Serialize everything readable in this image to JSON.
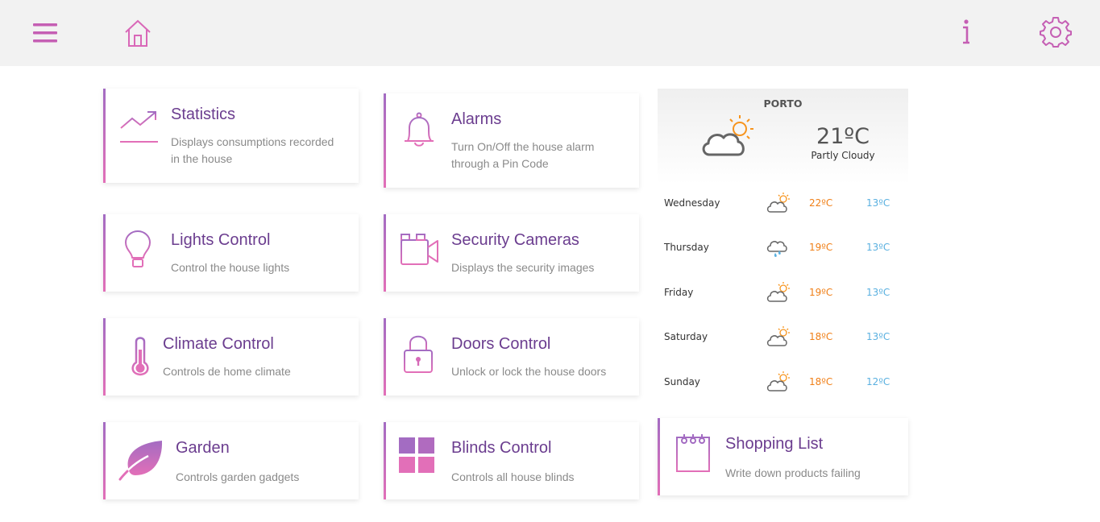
{
  "header": {
    "menu_icon": "hamburger-menu-icon",
    "home_icon": "home-icon",
    "info_icon": "info-icon",
    "settings_icon": "gear-icon"
  },
  "colors": {
    "accent_purple": "#6b3d8f",
    "accent_pink": "#e26fb8",
    "icon_gradient_top": "#a36cc2",
    "temp_high": "#f07f17",
    "temp_low": "#5ab0e0"
  },
  "cards": {
    "statistics": {
      "title": "Statistics",
      "desc": "Displays consumptions recorded in the house",
      "icon": "trend-chart-icon"
    },
    "alarms": {
      "title": "Alarms",
      "desc": "Turn On/Off the house alarm through a Pin Code",
      "icon": "bell-icon"
    },
    "lights": {
      "title": "Lights Control",
      "desc": "Control the house lights",
      "icon": "light-bulb-icon"
    },
    "cameras": {
      "title": "Security Cameras",
      "desc": "Displays the security images",
      "icon": "video-camera-icon"
    },
    "climate": {
      "title": "Climate Control",
      "desc": "Controls de home climate",
      "icon": "thermometer-icon"
    },
    "doors": {
      "title": "Doors Control",
      "desc": "Unlock or lock the house doors",
      "icon": "padlock-icon"
    },
    "garden": {
      "title": "Garden",
      "desc": "Controls garden gadgets",
      "icon": "leaf-icon"
    },
    "blinds": {
      "title": "Blinds Control",
      "desc": "Controls all house blinds",
      "icon": "blinds-grid-icon"
    },
    "shopping": {
      "title": "Shopping List",
      "desc": "Write down products failing",
      "icon": "notepad-icon"
    }
  },
  "weather": {
    "city": "PORTO",
    "temperature": "21ºC",
    "condition": "Partly Cloudy",
    "icon": "partly-cloudy-icon",
    "forecast": [
      {
        "day": "Wednesday",
        "high": "22ºC",
        "low": "13ºC",
        "icon": "partly-cloudy-icon"
      },
      {
        "day": "Thursday",
        "high": "19ºC",
        "low": "13ºC",
        "icon": "rain-cloud-icon"
      },
      {
        "day": "Friday",
        "high": "19ºC",
        "low": "13ºC",
        "icon": "partly-cloudy-icon"
      },
      {
        "day": "Saturday",
        "high": "18ºC",
        "low": "13ºC",
        "icon": "partly-cloudy-icon"
      },
      {
        "day": "Sunday",
        "high": "18ºC",
        "low": "12ºC",
        "icon": "partly-cloudy-icon"
      }
    ]
  }
}
